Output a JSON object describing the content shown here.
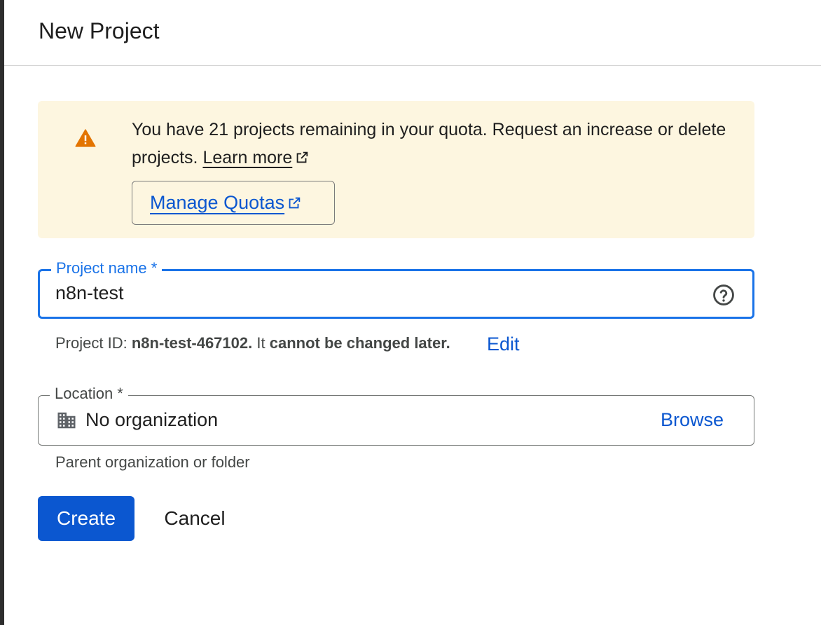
{
  "header": {
    "title": "New Project"
  },
  "quota_banner": {
    "message": "You have 21 projects remaining in your quota. Request an increase or delete projects.",
    "learn_more_label": "Learn more",
    "manage_quotas_label": "Manage Quotas",
    "icon": "warning-icon",
    "icon_color": "#e37400"
  },
  "project_name": {
    "label": "Project name *",
    "value": "n8n-test",
    "help_icon": "help-circle-icon"
  },
  "project_id": {
    "prefix": "Project ID:",
    "id": "n8n-test-467102.",
    "middle": "It",
    "suffix": "cannot be changed later.",
    "edit_label": "Edit"
  },
  "location": {
    "label": "Location *",
    "value": "No organization",
    "browse_label": "Browse",
    "hint": "Parent organization or folder",
    "icon": "building-icon"
  },
  "actions": {
    "create_label": "Create",
    "cancel_label": "Cancel"
  },
  "colors": {
    "accent": "#0b57d0",
    "focus_border": "#1a73e8",
    "banner_background": "#fdf6e0"
  }
}
